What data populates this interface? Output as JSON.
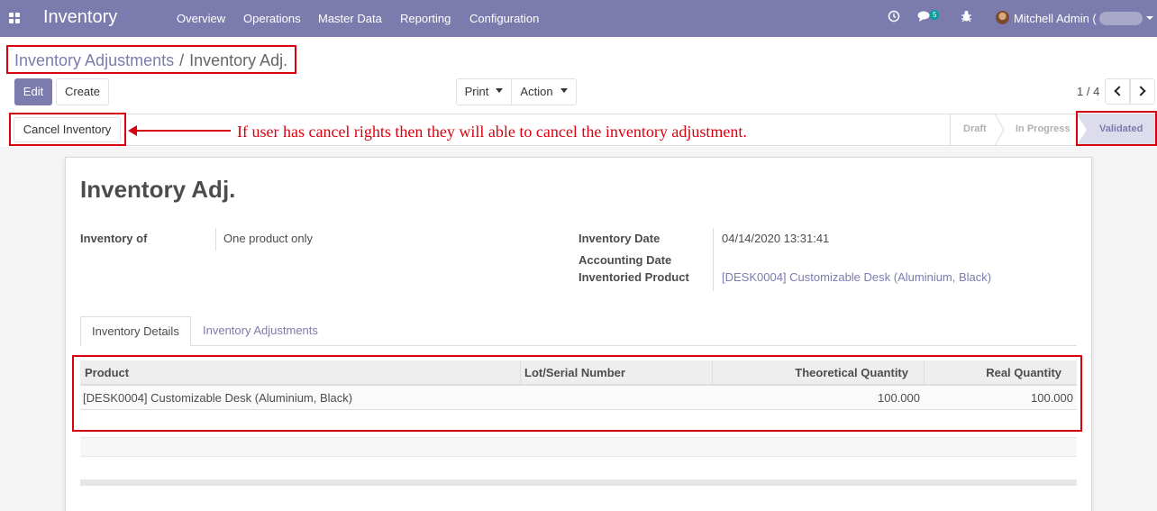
{
  "navbar": {
    "app_title": "Inventory",
    "menu": [
      "Overview",
      "Operations",
      "Master Data",
      "Reporting",
      "Configuration"
    ],
    "messages_count": "5",
    "user_name": "Mitchell Admin ("
  },
  "breadcrumb": {
    "parent": "Inventory Adjustments",
    "separator": "/",
    "current": "Inventory Adj."
  },
  "buttons": {
    "edit": "Edit",
    "create": "Create",
    "print": "Print",
    "action": "Action",
    "cancel_inventory": "Cancel Inventory"
  },
  "pager": {
    "value": "1 / 4"
  },
  "statusbar": {
    "steps": [
      "Draft",
      "In Progress",
      "Validated"
    ],
    "active": "Validated"
  },
  "annotation": "If user has cancel rights then they will able to cancel the inventory adjustment.",
  "form": {
    "title": "Inventory Adj.",
    "inventory_of_label": "Inventory of",
    "inventory_of_value": "One product only",
    "inventory_date_label": "Inventory Date",
    "inventory_date_value": "04/14/2020 13:31:41",
    "accounting_date_label": "Accounting Date",
    "inventoried_product_label": "Inventoried Product",
    "inventoried_product_value": "[DESK0004] Customizable Desk (Aluminium, Black)"
  },
  "tabs": [
    "Inventory Details",
    "Inventory Adjustments"
  ],
  "table": {
    "headers": [
      "Product",
      "Lot/Serial Number",
      "Theoretical Quantity",
      "Real Quantity"
    ],
    "rows": [
      {
        "product": "[DESK0004] Customizable Desk (Aluminium, Black)",
        "lot": "",
        "theoretical": "100.000",
        "real": "100.000"
      }
    ]
  },
  "colors": {
    "brand": "#7c7bad",
    "annotation_red": "#d9000f",
    "active_status_bg": "#dcdcec"
  }
}
